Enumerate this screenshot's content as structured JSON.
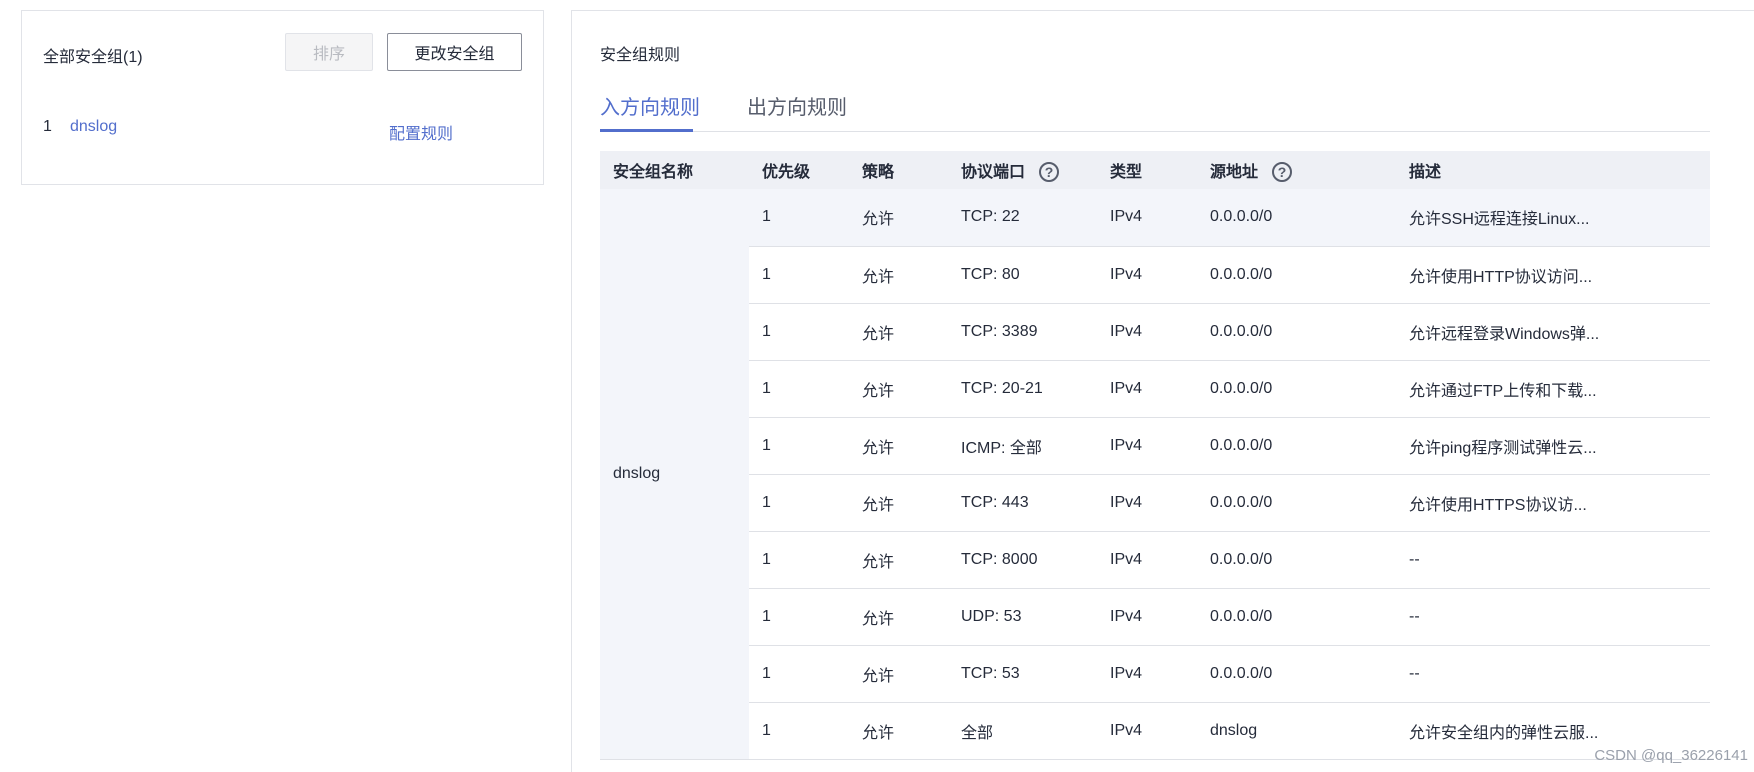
{
  "left_panel": {
    "title": "全部安全组(1)",
    "sort_button": "排序",
    "change_button": "更改安全组",
    "groups": [
      {
        "index": "1",
        "name": "dnslog",
        "config_link": "配置规则"
      }
    ]
  },
  "right_panel": {
    "title": "安全组规则",
    "tabs": [
      {
        "label": "入方向规则",
        "active": true
      },
      {
        "label": "出方向规则",
        "active": false
      }
    ],
    "table": {
      "headers": {
        "group_name": "安全组名称",
        "priority": "优先级",
        "policy": "策略",
        "protocol_port": "协议端口",
        "type": "类型",
        "source": "源地址",
        "description": "描述"
      },
      "help_icon_glyph": "?",
      "group_name": "dnslog",
      "rows": [
        {
          "priority": "1",
          "policy": "允许",
          "protocol_port": "TCP: 22",
          "type": "IPv4",
          "source": "0.0.0.0/0",
          "description": "允许SSH远程连接Linux..."
        },
        {
          "priority": "1",
          "policy": "允许",
          "protocol_port": "TCP: 80",
          "type": "IPv4",
          "source": "0.0.0.0/0",
          "description": "允许使用HTTP协议访问..."
        },
        {
          "priority": "1",
          "policy": "允许",
          "protocol_port": "TCP: 3389",
          "type": "IPv4",
          "source": "0.0.0.0/0",
          "description": "允许远程登录Windows弹..."
        },
        {
          "priority": "1",
          "policy": "允许",
          "protocol_port": "TCP: 20-21",
          "type": "IPv4",
          "source": "0.0.0.0/0",
          "description": "允许通过FTP上传和下载..."
        },
        {
          "priority": "1",
          "policy": "允许",
          "protocol_port": "ICMP: 全部",
          "type": "IPv4",
          "source": "0.0.0.0/0",
          "description": "允许ping程序测试弹性云..."
        },
        {
          "priority": "1",
          "policy": "允许",
          "protocol_port": "TCP: 443",
          "type": "IPv4",
          "source": "0.0.0.0/0",
          "description": "允许使用HTTPS协议访..."
        },
        {
          "priority": "1",
          "policy": "允许",
          "protocol_port": "TCP: 8000",
          "type": "IPv4",
          "source": "0.0.0.0/0",
          "description": "--"
        },
        {
          "priority": "1",
          "policy": "允许",
          "protocol_port": "UDP: 53",
          "type": "IPv4",
          "source": "0.0.0.0/0",
          "description": "--"
        },
        {
          "priority": "1",
          "policy": "允许",
          "protocol_port": "TCP: 53",
          "type": "IPv4",
          "source": "0.0.0.0/0",
          "description": "--"
        },
        {
          "priority": "1",
          "policy": "允许",
          "protocol_port": "全部",
          "type": "IPv4",
          "source": "dnslog",
          "description": "允许安全组内的弹性云服..."
        }
      ]
    }
  },
  "watermark": "CSDN @qq_36226141",
  "colors": {
    "accent": "#526ecc",
    "header_bg": "#eef0f5",
    "border": "#dfe1e6",
    "text": "#252b3a"
  }
}
